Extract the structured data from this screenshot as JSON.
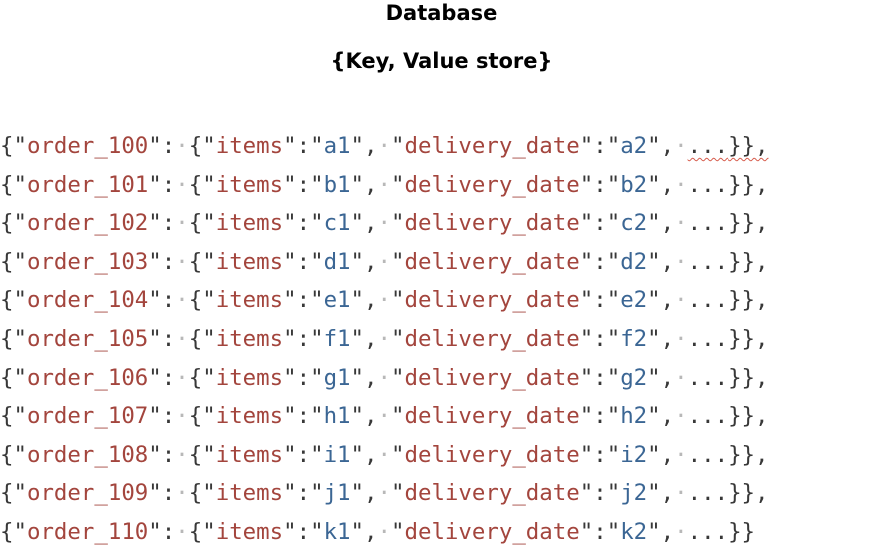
{
  "title": "Database",
  "subtitle": "{Key, Value store}",
  "colors": {
    "keys": "#a3453d",
    "values": "#3b6694",
    "punctuation": "#383838",
    "whitespace_dots": "#b8b8b8",
    "spellcheck_squiggle": "#d65a4a"
  },
  "records": [
    {
      "order_key": "order_100",
      "items_key": "items",
      "items_value": "a1",
      "date_key": "delivery_date",
      "date_value": "a2",
      "ellipsis": "...",
      "terminator": "}},"
    },
    {
      "order_key": "order_101",
      "items_key": "items",
      "items_value": "b1",
      "date_key": "delivery_date",
      "date_value": "b2",
      "ellipsis": "...",
      "terminator": "}},"
    },
    {
      "order_key": "order_102",
      "items_key": "items",
      "items_value": "c1",
      "date_key": "delivery_date",
      "date_value": "c2",
      "ellipsis": "...",
      "terminator": "}},"
    },
    {
      "order_key": "order_103",
      "items_key": "items",
      "items_value": "d1",
      "date_key": "delivery_date",
      "date_value": "d2",
      "ellipsis": "...",
      "terminator": "}},"
    },
    {
      "order_key": "order_104",
      "items_key": "items",
      "items_value": "e1",
      "date_key": "delivery_date",
      "date_value": "e2",
      "ellipsis": "...",
      "terminator": "}},"
    },
    {
      "order_key": "order_105",
      "items_key": "items",
      "items_value": "f1",
      "date_key": "delivery_date",
      "date_value": "f2",
      "ellipsis": "...",
      "terminator": "}},"
    },
    {
      "order_key": "order_106",
      "items_key": "items",
      "items_value": "g1",
      "date_key": "delivery_date",
      "date_value": "g2",
      "ellipsis": "...",
      "terminator": "}},"
    },
    {
      "order_key": "order_107",
      "items_key": "items",
      "items_value": "h1",
      "date_key": "delivery_date",
      "date_value": "h2",
      "ellipsis": "...",
      "terminator": "}},"
    },
    {
      "order_key": "order_108",
      "items_key": "items",
      "items_value": "i1",
      "date_key": "delivery_date",
      "date_value": "i2",
      "ellipsis": "...",
      "terminator": "}},"
    },
    {
      "order_key": "order_109",
      "items_key": "items",
      "items_value": "j1",
      "date_key": "delivery_date",
      "date_value": "j2",
      "ellipsis": "...",
      "terminator": "}},"
    },
    {
      "order_key": "order_110",
      "items_key": "items",
      "items_value": "k1",
      "date_key": "delivery_date",
      "date_value": "k2",
      "ellipsis": "...",
      "terminator": "}}"
    }
  ]
}
